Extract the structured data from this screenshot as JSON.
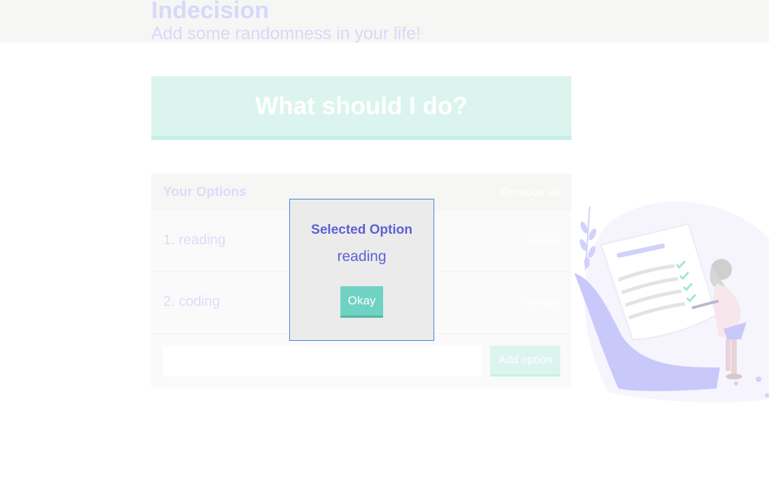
{
  "header": {
    "title": "Indecision",
    "subtitle": "Add some randomness in your life!"
  },
  "action": {
    "label": "What should I do?"
  },
  "options": {
    "title": "Your Options",
    "remove_all_label": "Remove all",
    "items": [
      {
        "text": "1. reading",
        "remove_label": "remove"
      },
      {
        "text": "2. coding",
        "remove_label": "remove"
      }
    ],
    "input_value": "",
    "add_label": "Add option"
  },
  "modal": {
    "title": "Selected Option",
    "selected": "reading",
    "okay_label": "Okay"
  },
  "illustration": {
    "icon": "checklist-illustration"
  },
  "colors": {
    "accent": "#6fd2c2",
    "modal_text": "#5f5fd6",
    "modal_border": "#3f87d7",
    "illustration_purple": "#c9c8fb"
  }
}
